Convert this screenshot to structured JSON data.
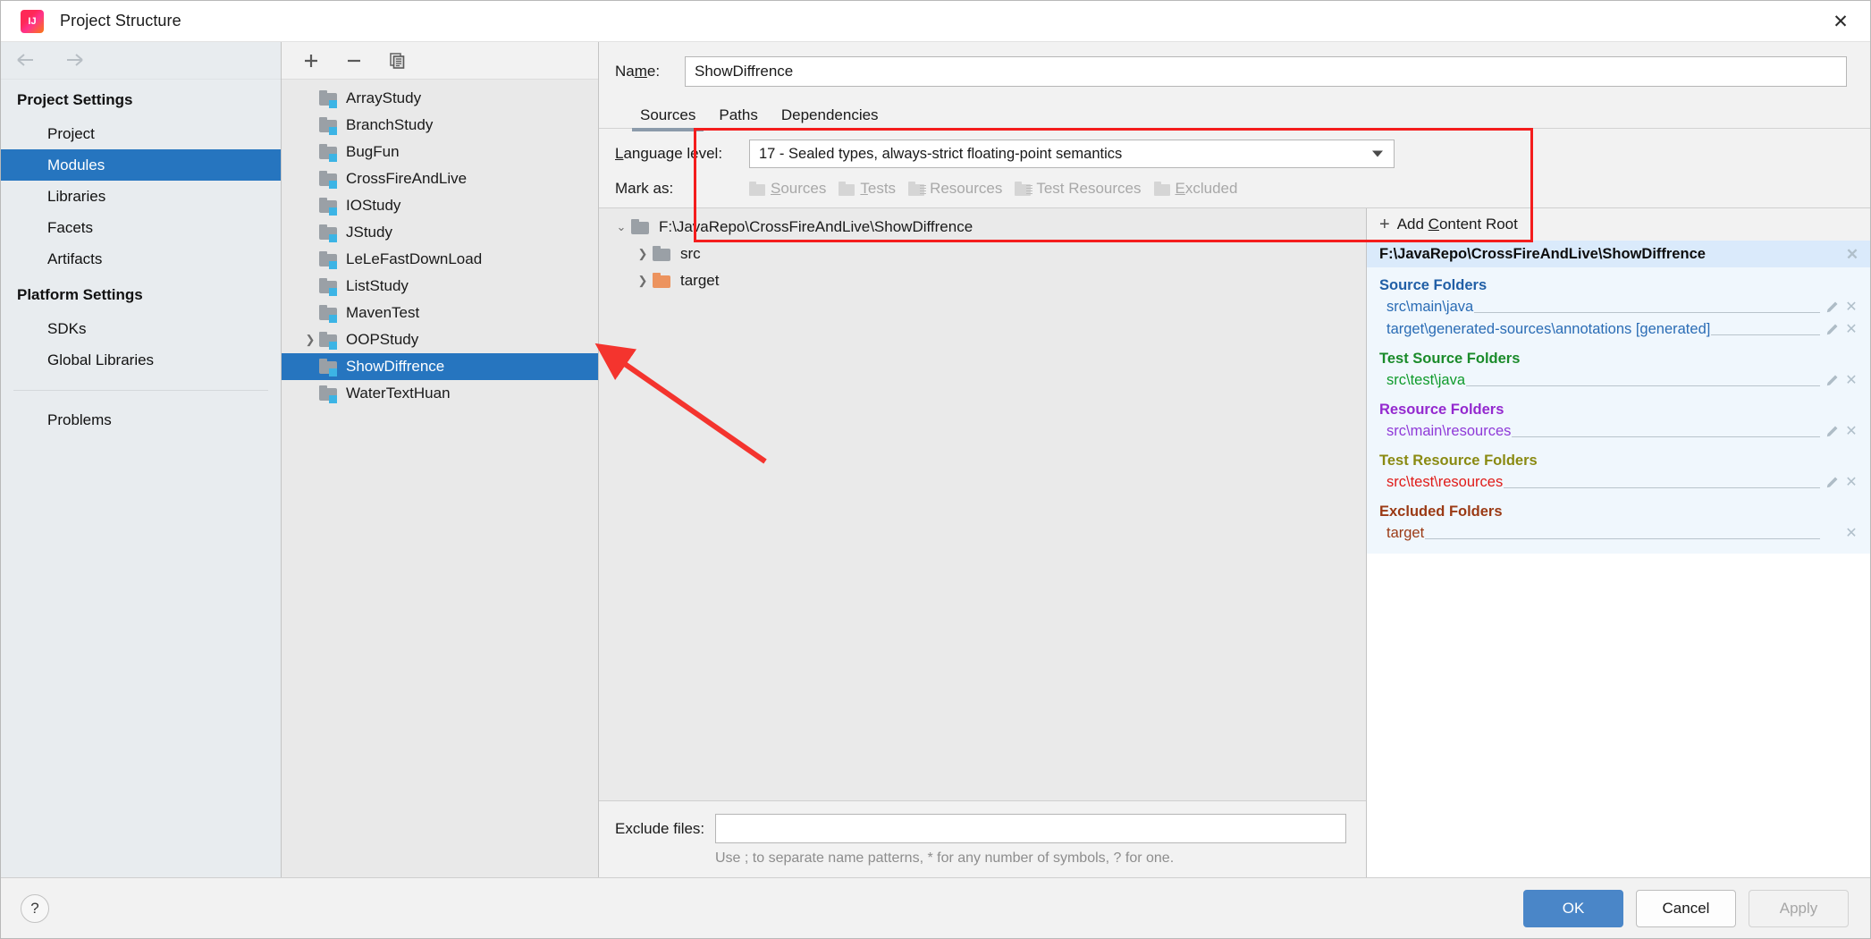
{
  "window": {
    "title": "Project Structure",
    "logo_icon": "intellij-idea-icon",
    "close_icon": "close-icon"
  },
  "sidebar": {
    "back_icon": "arrow-left-icon",
    "forward_icon": "arrow-right-icon",
    "groups": [
      {
        "title": "Project Settings",
        "items": [
          {
            "label": "Project",
            "selected": false
          },
          {
            "label": "Modules",
            "selected": true
          },
          {
            "label": "Libraries",
            "selected": false
          },
          {
            "label": "Facets",
            "selected": false
          },
          {
            "label": "Artifacts",
            "selected": false
          }
        ]
      },
      {
        "title": "Platform Settings",
        "items": [
          {
            "label": "SDKs",
            "selected": false
          },
          {
            "label": "Global Libraries",
            "selected": false
          }
        ]
      }
    ],
    "standalone": {
      "label": "Problems",
      "selected": false
    }
  },
  "module_list": {
    "toolbar": {
      "add_icon": "plus-icon",
      "remove_icon": "minus-icon",
      "copy_icon": "copy-icon"
    },
    "items": [
      {
        "label": "ArrayStudy",
        "expandable": false,
        "selected": false
      },
      {
        "label": "BranchStudy",
        "expandable": false,
        "selected": false
      },
      {
        "label": "BugFun",
        "expandable": false,
        "selected": false
      },
      {
        "label": "CrossFireAndLive",
        "expandable": false,
        "selected": false
      },
      {
        "label": "IOStudy",
        "expandable": false,
        "selected": false
      },
      {
        "label": "JStudy",
        "expandable": false,
        "selected": false
      },
      {
        "label": "LeLeFastDownLoad",
        "expandable": false,
        "selected": false
      },
      {
        "label": "ListStudy",
        "expandable": false,
        "selected": false
      },
      {
        "label": "MavenTest",
        "expandable": false,
        "selected": false
      },
      {
        "label": "OOPStudy",
        "expandable": true,
        "selected": false
      },
      {
        "label": "ShowDiffrence",
        "expandable": false,
        "selected": true
      },
      {
        "label": "WaterTextHuan",
        "expandable": false,
        "selected": false
      }
    ]
  },
  "detail": {
    "name_label": "Name:",
    "name_value": "ShowDiffrence",
    "tabs": [
      {
        "label": "Sources",
        "active": true
      },
      {
        "label": "Paths",
        "active": false
      },
      {
        "label": "Dependencies",
        "active": false
      }
    ],
    "language_level_label": "Language level:",
    "language_level_value": "17 - Sealed types, always-strict floating-point semantics",
    "mark_as_label": "Mark as:",
    "mark_as_buttons": [
      {
        "label": "Sources",
        "icon": "folder-icon"
      },
      {
        "label": "Tests",
        "icon": "folder-icon"
      },
      {
        "label": "Resources",
        "icon": "folder-resources-icon"
      },
      {
        "label": "Test Resources",
        "icon": "folder-test-resources-icon"
      },
      {
        "label": "Excluded",
        "icon": "folder-icon"
      }
    ],
    "tree": [
      {
        "label": "F:\\JavaRepo\\CrossFireAndLive\\ShowDiffrence",
        "depth": 0,
        "expanded": true,
        "icon": "folder-icon",
        "color": "gray"
      },
      {
        "label": "src",
        "depth": 1,
        "expanded": false,
        "icon": "folder-icon",
        "color": "gray"
      },
      {
        "label": "target",
        "depth": 1,
        "expanded": false,
        "icon": "folder-excluded-icon",
        "color": "orange"
      }
    ],
    "exclude_files_label": "Exclude files:",
    "exclude_files_value": "",
    "exclude_files_hint": "Use ; to separate name patterns, * for any number of symbols, ? for one."
  },
  "content_roots": {
    "add_button_label": "Add Content Root",
    "add_button_icon": "plus-icon",
    "root_path": "F:\\JavaRepo\\CrossFireAndLive\\ShowDiffrence",
    "remove_root_icon": "close-icon",
    "sections": [
      {
        "title": "Source Folders",
        "kind": "src",
        "rows": [
          {
            "path": "src\\main\\java",
            "has_edit": true,
            "has_remove": true
          },
          {
            "path": "target\\generated-sources\\annotations [generated]",
            "has_edit": true,
            "has_remove": true
          }
        ]
      },
      {
        "title": "Test Source Folders",
        "kind": "tsrc",
        "rows": [
          {
            "path": "src\\test\\java",
            "has_edit": true,
            "has_remove": true
          }
        ]
      },
      {
        "title": "Resource Folders",
        "kind": "res",
        "rows": [
          {
            "path": "src\\main\\resources",
            "has_edit": true,
            "has_remove": true
          }
        ]
      },
      {
        "title": "Test Resource Folders",
        "kind": "tres",
        "rows": [
          {
            "path": "src\\test\\resources",
            "has_edit": true,
            "has_remove": true
          }
        ]
      },
      {
        "title": "Excluded Folders",
        "kind": "excl",
        "rows": [
          {
            "path": "target",
            "has_edit": false,
            "has_remove": true
          }
        ]
      }
    ],
    "edit_icon": "pencil-icon",
    "remove_icon": "close-icon"
  },
  "footer": {
    "help_label": "?",
    "ok_label": "OK",
    "cancel_label": "Cancel",
    "apply_label": "Apply",
    "apply_disabled": true
  },
  "annotations": {
    "rectangle_color": "#f41d1d",
    "arrow_color": "#f4342e"
  },
  "colors": {
    "selection_blue": "#2675bf",
    "primary_button": "#4a86c8",
    "source_folders": "#2a6cb5",
    "test_source_folders": "#0f9b2b",
    "resource_folders": "#8f39d8",
    "test_resource_folders": "#e01b18",
    "excluded_folders": "#9b3a15"
  }
}
